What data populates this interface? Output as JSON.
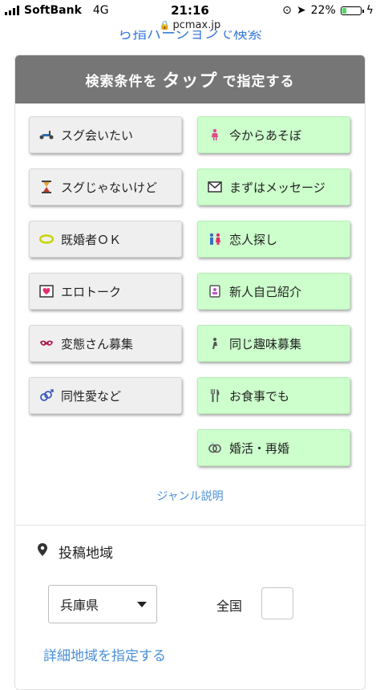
{
  "status_bar": {
    "carrier": "SoftBank",
    "network": "4G",
    "time": "21:16",
    "battery_percent": "22%",
    "battery_level": 0.22
  },
  "browser": {
    "url": "pcmax.jp"
  },
  "top_link_peek": "ら指バージョンで検索",
  "search": {
    "header_prefix": "検索条件を",
    "header_emphasis": "タップ",
    "header_suffix": "で指定する",
    "buttons_left": [
      {
        "label": "スグ会いたい",
        "icon": "scooter-icon"
      },
      {
        "label": "スグじゃないけど",
        "icon": "hourglass-icon"
      },
      {
        "label": "既婚者ＯＫ",
        "icon": "ring-icon"
      },
      {
        "label": "エロトーク",
        "icon": "heart-letter-icon"
      },
      {
        "label": "変態さん募集",
        "icon": "mask-icon"
      },
      {
        "label": "同性愛など",
        "icon": "gender-symbols-icon"
      }
    ],
    "buttons_right": [
      {
        "label": "今からあそぼ",
        "icon": "dancer-icon"
      },
      {
        "label": "まずはメッセージ",
        "icon": "envelope-icon"
      },
      {
        "label": "恋人探し",
        "icon": "couple-icon"
      },
      {
        "label": "新人自己紹介",
        "icon": "profile-card-icon"
      },
      {
        "label": "同じ趣味募集",
        "icon": "hobby-figure-icon"
      },
      {
        "label": "お食事でも",
        "icon": "fork-knife-icon"
      },
      {
        "label": "婚活・再婚",
        "icon": "wedding-rings-icon"
      }
    ],
    "genre_link": "ジャンル説明"
  },
  "area": {
    "title": "投稿地域",
    "prefecture_selected": "兵庫県",
    "nationwide_label": "全国",
    "detail_link": "詳細地域を指定する"
  },
  "colors": {
    "header_bg": "#767676",
    "button_gray": "#efefef",
    "button_green": "#ccffcc",
    "link_blue": "#4a8fd8"
  }
}
